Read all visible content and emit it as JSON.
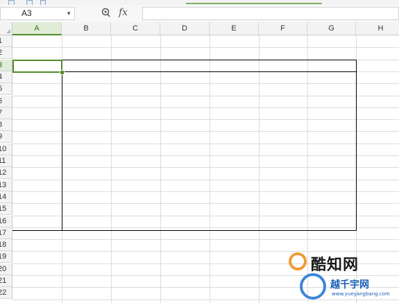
{
  "formula_bar": {
    "cell_reference": "A3",
    "function_label": "fx",
    "formula_value": ""
  },
  "columns": [
    "A",
    "B",
    "C",
    "D",
    "E",
    "F",
    "G",
    "H"
  ],
  "rows": [
    "1",
    "2",
    "3",
    "4",
    "5",
    "6",
    "7",
    "8",
    "9",
    "10",
    "11",
    "12",
    "13",
    "14",
    "15",
    "16",
    "17",
    "18",
    "19",
    "20",
    "21",
    "22"
  ],
  "selection": {
    "column": "A",
    "row": "3"
  },
  "watermark": {
    "line1": "酷知网",
    "line2": "越千宇网",
    "url": "www.yueyangbang.com"
  },
  "colors": {
    "selection_accent": "#4f8a2b",
    "header_bg": "#f3f3f3",
    "grid": "#dcdcdc",
    "table_border": "#000000",
    "watermark_blue": "#1a5fb4",
    "watermark_orange": "#f29b38"
  }
}
